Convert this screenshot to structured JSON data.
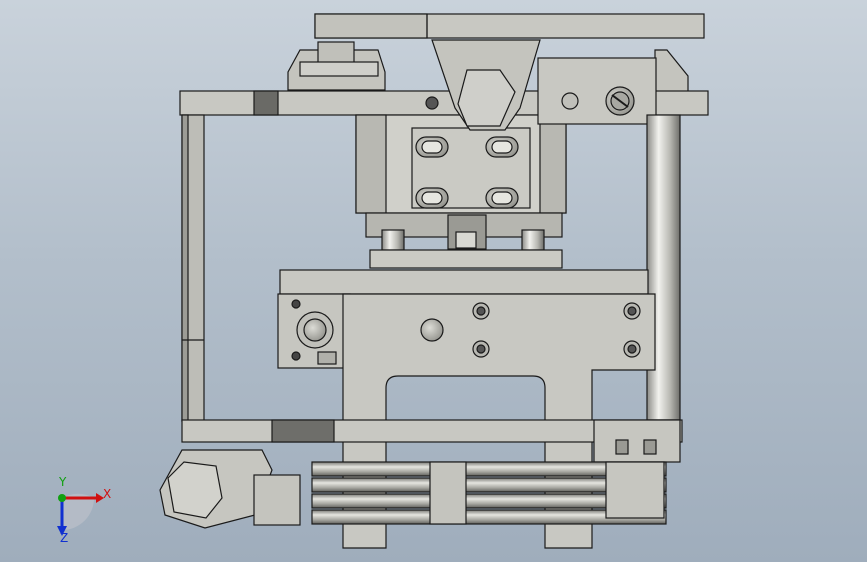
{
  "viewport": {
    "background_top": "#c9d2db",
    "background_bottom": "#9fadbc",
    "part_color": "#c8c8c2",
    "edge_color": "#1a1a1a"
  },
  "triad": {
    "x_label": "X",
    "y_label": "Y",
    "z_label": "Z",
    "x_color": "#d01010",
    "y_color": "#10a010",
    "z_color": "#1030d0"
  }
}
